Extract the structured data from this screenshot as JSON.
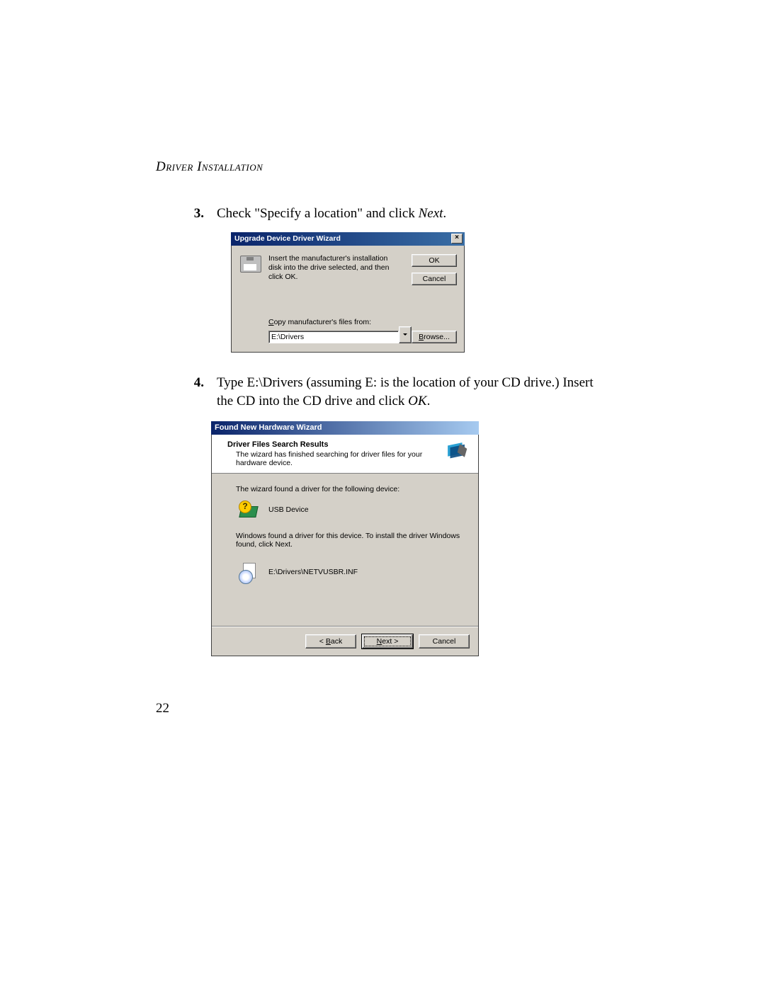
{
  "section_title": "Driver Installation",
  "step3": {
    "num": "3.",
    "text_before": "Check \"Specify a location\" and click ",
    "italic": "Next",
    "text_after": "."
  },
  "dialog1": {
    "title": "Upgrade Device Driver Wizard",
    "close": "×",
    "message": "Insert the manufacturer's installation disk into the drive selected, and then click OK.",
    "ok": "OK",
    "cancel": "Cancel",
    "copy_label": "Copy manufacturer's files from:",
    "input_value": "E:\\Drivers",
    "browse": "Browse..."
  },
  "step4": {
    "num": "4.",
    "text_before": "Type E:\\Drivers (assuming E: is the location of your CD drive.) Insert the CD into the CD drive and click ",
    "italic": "OK",
    "text_after": "."
  },
  "dialog2": {
    "title": "Found New Hardware Wizard",
    "banner_title": "Driver Files Search Results",
    "banner_sub": "The wizard has finished searching for driver files for your hardware device.",
    "found_line": "The wizard found a driver for the following device:",
    "device_name": "USB Device",
    "install_line": "Windows found a driver for this device. To install the driver Windows found, click Next.",
    "driver_path": "E:\\Drivers\\NETVUSBR.INF",
    "back": "< Back",
    "next": "Next >",
    "cancel": "Cancel"
  },
  "page_number": "22"
}
